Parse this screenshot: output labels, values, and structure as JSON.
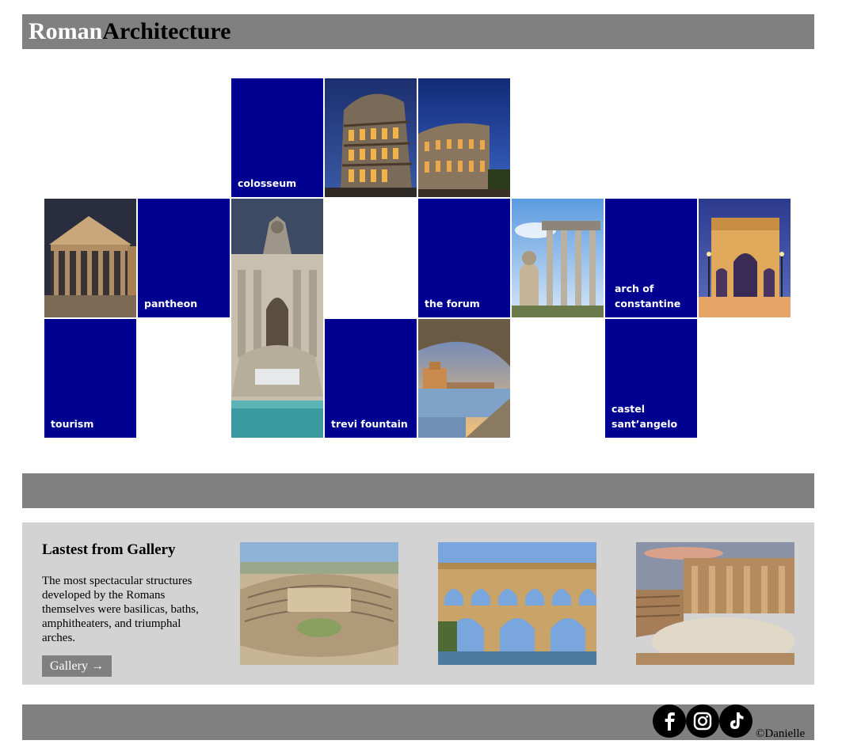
{
  "header": {
    "title_part1": "Roman",
    "title_part2": "Architecture"
  },
  "tiles": {
    "colosseum": "colosseum",
    "pantheon": "pantheon",
    "the_forum": "the forum",
    "arch_of_constantine": "arch of constantine",
    "tourism": "tourism",
    "trevi_fountain": "trevi fountain",
    "castel_santangelo": "castel sant’angelo"
  },
  "gallery": {
    "heading": "Lastest from Gallery",
    "description": "The most spectacular structures developed by the Romans themselves were basilicas, baths, amphitheaters, and triumphal arches.",
    "button_label": "Gallery →"
  },
  "footer": {
    "social_icons": [
      "facebook-icon",
      "instagram-icon",
      "tiktok-icon"
    ],
    "copyright": "©Danielle"
  },
  "colors": {
    "bar_gray": "#808080",
    "tile_blue": "#000091",
    "gallery_bg": "#d3d3d3"
  }
}
